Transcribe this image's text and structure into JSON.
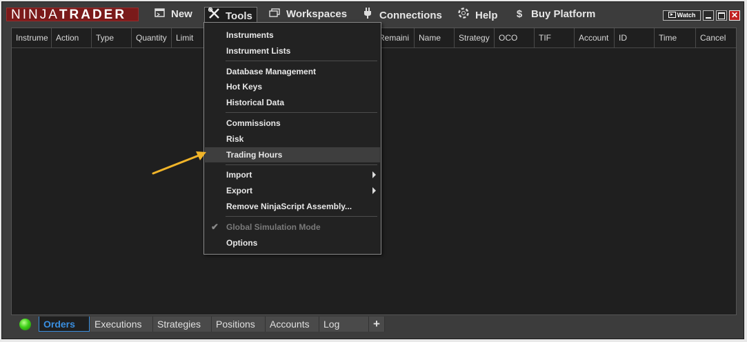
{
  "logo": {
    "part1": "NINJA",
    "part2": "TRADER"
  },
  "menubar": {
    "new": {
      "label": "New",
      "icon": "new-window-icon"
    },
    "tools": {
      "label": "Tools",
      "icon": "wrench-screwdriver-icon"
    },
    "workspaces": {
      "label": "Workspaces",
      "icon": "workspaces-icon"
    },
    "connections": {
      "label": "Connections",
      "icon": "plug-icon"
    },
    "help": {
      "label": "Help",
      "icon": "lifebuoy-icon"
    },
    "buy": {
      "label": "Buy Platform",
      "icon": "dollar-icon"
    }
  },
  "window_controls": {
    "watch": "Watch"
  },
  "grid": {
    "columns": [
      "Instrume",
      "Action",
      "Type",
      "Quantity",
      "Limit",
      "Remaini",
      "Name",
      "Strategy",
      "OCO",
      "TIF",
      "Account",
      "ID",
      "Time",
      "Cancel"
    ]
  },
  "tools_menu": {
    "items": [
      {
        "label": "Instruments"
      },
      {
        "label": "Instrument Lists"
      },
      {
        "label": "Database Management"
      },
      {
        "label": "Hot Keys"
      },
      {
        "label": "Historical Data"
      },
      {
        "label": "Commissions"
      },
      {
        "label": "Risk"
      },
      {
        "label": "Trading Hours",
        "state": "hovered"
      },
      {
        "label": "Import",
        "submenu": true
      },
      {
        "label": "Export",
        "submenu": true
      },
      {
        "label": "Remove NinjaScript Assembly..."
      },
      {
        "label": "Global Simulation Mode",
        "checked": true,
        "disabled": true
      },
      {
        "label": "Options"
      }
    ]
  },
  "bottom_tabs": {
    "tabs": [
      "Orders",
      "Executions",
      "Strategies",
      "Positions",
      "Accounts",
      "Log"
    ],
    "active": "Orders",
    "add": "+"
  },
  "colors": {
    "accent": "#3a8fe0",
    "annotation_arrow": "#f0b429",
    "status_ok": "#3ed018",
    "logo_bg": "#7a1a1a"
  }
}
